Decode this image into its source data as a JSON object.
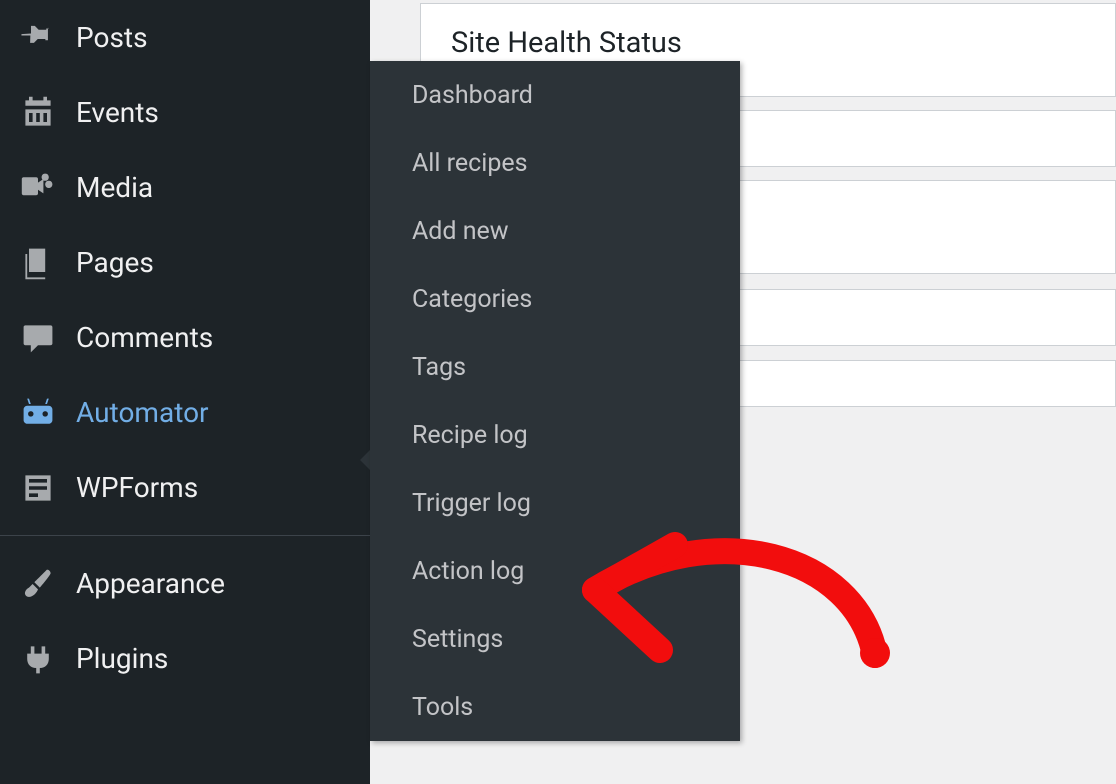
{
  "sidebar": {
    "items": [
      {
        "label": "Posts"
      },
      {
        "label": "Events"
      },
      {
        "label": "Media"
      },
      {
        "label": "Pages"
      },
      {
        "label": "Comments"
      },
      {
        "label": "Automator"
      },
      {
        "label": "WPForms"
      },
      {
        "label": "Appearance"
      },
      {
        "label": "Plugins"
      }
    ]
  },
  "submenu": {
    "items": [
      {
        "label": "Dashboard"
      },
      {
        "label": "All recipes"
      },
      {
        "label": "Add new"
      },
      {
        "label": "Categories"
      },
      {
        "label": "Tags"
      },
      {
        "label": "Recipe log"
      },
      {
        "label": "Trigger log"
      },
      {
        "label": "Action log"
      },
      {
        "label": "Settings"
      },
      {
        "label": "Tools"
      }
    ]
  },
  "content": {
    "panel_title": "Site Health Status"
  }
}
